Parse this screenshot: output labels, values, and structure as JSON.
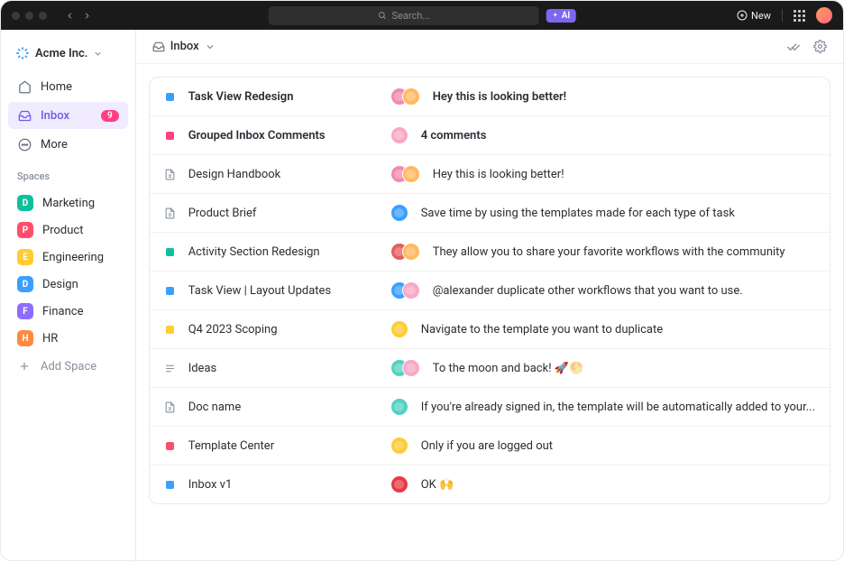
{
  "titlebar": {
    "search_placeholder": "Search...",
    "ai_label": "AI",
    "new_label": "New"
  },
  "workspace": {
    "name": "Acme Inc."
  },
  "nav": {
    "home": "Home",
    "inbox": "Inbox",
    "inbox_badge": "9",
    "more": "More"
  },
  "sections": {
    "spaces": "Spaces",
    "add_space": "Add Space"
  },
  "spaces": [
    {
      "letter": "D",
      "label": "Marketing",
      "color": "#0fbf9c"
    },
    {
      "letter": "P",
      "label": "Product",
      "color": "#ff4d6d"
    },
    {
      "letter": "E",
      "label": "Engineering",
      "color": "#ffcc33"
    },
    {
      "letter": "D",
      "label": "Design",
      "color": "#3aa0ff"
    },
    {
      "letter": "F",
      "label": "Finance",
      "color": "#8e6cff"
    },
    {
      "letter": "H",
      "label": "HR",
      "color": "#ff8a3d"
    }
  ],
  "header": {
    "title": "Inbox"
  },
  "inbox": [
    {
      "icon": "status",
      "icon_color": "#3aa0ff",
      "title": "Task View Redesign",
      "bold": true,
      "avatars": [
        "#f28ab2",
        "#ffb960"
      ],
      "message": "Hey this is looking better!"
    },
    {
      "icon": "status",
      "icon_color": "#ff3f7f",
      "title": "Grouped Inbox Comments",
      "bold": true,
      "avatars": [
        "#f9a8c5"
      ],
      "message": "4 comments"
    },
    {
      "icon": "doc",
      "icon_color": "#87909e",
      "title": "Design Handbook",
      "bold": false,
      "avatars": [
        "#f28ab2",
        "#ffb960"
      ],
      "message": "Hey this is looking better!"
    },
    {
      "icon": "doc",
      "icon_color": "#87909e",
      "title": "Product Brief",
      "bold": false,
      "avatars": [
        "#3aa0ff"
      ],
      "message": "Save time by using the templates made for each type of task"
    },
    {
      "icon": "status",
      "icon_color": "#0fbf9c",
      "title": "Activity Section Redesign",
      "bold": false,
      "avatars": [
        "#e85d5d",
        "#ffb960"
      ],
      "message": "They allow you to share your favorite workflows with the community"
    },
    {
      "icon": "status",
      "icon_color": "#3aa0ff",
      "title": "Task View | Layout Updates",
      "bold": false,
      "avatars": [
        "#3aa0ff",
        "#f9a8c5"
      ],
      "message": "@alexander duplicate other workflows that you want to use."
    },
    {
      "icon": "status",
      "icon_color": "#ffcc33",
      "title": "Q4 2023 Scoping",
      "bold": false,
      "avatars": [
        "#ffcc33"
      ],
      "message": "Navigate to the template you want to duplicate"
    },
    {
      "icon": "list",
      "icon_color": "#87909e",
      "title": "Ideas",
      "bold": false,
      "avatars": [
        "#55d0c0",
        "#f9a8c5"
      ],
      "message": "To the moon and back! 🚀🌕"
    },
    {
      "icon": "doc",
      "icon_color": "#87909e",
      "title": "Doc name",
      "bold": false,
      "avatars": [
        "#55d0c0"
      ],
      "message": "If you're already signed in, the template will be automatically added to your..."
    },
    {
      "icon": "status",
      "icon_color": "#ff4d6d",
      "title": "Template Center",
      "bold": false,
      "avatars": [
        "#ffcc33"
      ],
      "message": "Only if you are logged out"
    },
    {
      "icon": "status",
      "icon_color": "#3aa0ff",
      "title": "Inbox v1",
      "bold": false,
      "avatars": [
        "#e63946"
      ],
      "message": "OK 🙌"
    }
  ]
}
